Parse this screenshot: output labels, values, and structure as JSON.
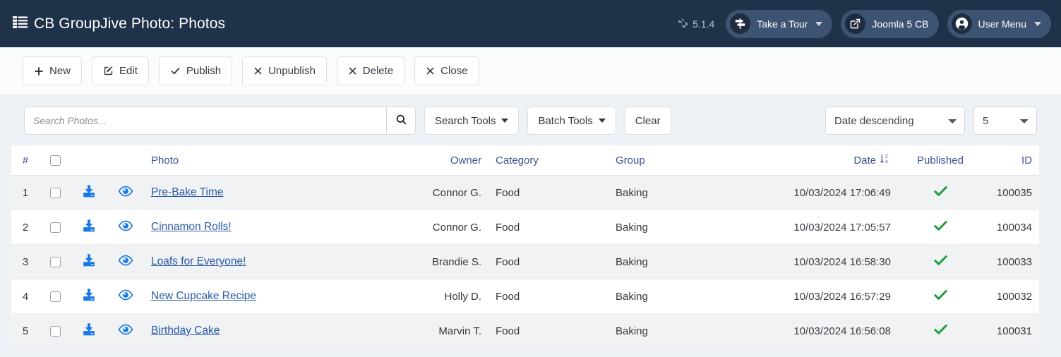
{
  "header": {
    "title": "CB GroupJive Photo: Photos",
    "title_icon": "list-icon",
    "version": "5.1.4",
    "version_icon": "joomla-logo-icon",
    "tour_button": {
      "label": "Take a Tour",
      "icon": "signpost-icon"
    },
    "joomla_button": {
      "label": "Joomla 5 CB",
      "icon": "external-link-icon"
    },
    "user_menu": {
      "label": "User Menu",
      "icon": "user-circle-icon"
    }
  },
  "toolbar": {
    "buttons": [
      {
        "label": "New",
        "icon": "plus-icon"
      },
      {
        "label": "Edit",
        "icon": "pencil-square-icon"
      },
      {
        "label": "Publish",
        "icon": "check-icon"
      },
      {
        "label": "Unpublish",
        "icon": "x-icon"
      },
      {
        "label": "Delete",
        "icon": "x-icon"
      },
      {
        "label": "Close",
        "icon": "x-icon"
      }
    ]
  },
  "filters": {
    "search_placeholder": "Search Photos...",
    "search_value": "",
    "search_icon": "search-icon",
    "search_tools_label": "Search Tools",
    "batch_tools_label": "Batch Tools",
    "clear_label": "Clear",
    "sort_value": "Date descending",
    "sort_options": [
      "Date descending"
    ],
    "limit_value": "5",
    "limit_options": [
      "5"
    ]
  },
  "table": {
    "columns": {
      "num": "#",
      "photo": "Photo",
      "owner": "Owner",
      "category": "Category",
      "group": "Group",
      "date": "Date",
      "published": "Published",
      "id": "ID"
    },
    "sort_indicator": {
      "column": "Date",
      "icon": "sort-down-za-icon"
    },
    "rows": [
      {
        "num": "1",
        "photo": "Pre-Bake Time",
        "owner": "Connor G.",
        "category": "Food",
        "group": "Baking",
        "date": "10/03/2024 17:06:49",
        "published": "published-check-icon",
        "id": "100035"
      },
      {
        "num": "2",
        "photo": "Cinnamon Rolls!",
        "owner": "Connor G.",
        "category": "Food",
        "group": "Baking",
        "date": "10/03/2024 17:05:57",
        "published": "published-check-icon",
        "id": "100034"
      },
      {
        "num": "3",
        "photo": "Loafs for Everyone!",
        "owner": "Brandie S.",
        "category": "Food",
        "group": "Baking",
        "date": "10/03/2024 16:58:30",
        "published": "published-check-icon",
        "id": "100033"
      },
      {
        "num": "4",
        "photo": "New Cupcake Recipe",
        "owner": "Holly D.",
        "category": "Food",
        "group": "Baking",
        "date": "10/03/2024 16:57:29",
        "published": "published-check-icon",
        "id": "100032"
      },
      {
        "num": "5",
        "photo": "Birthday Cake",
        "owner": "Marvin T.",
        "category": "Food",
        "group": "Baking",
        "date": "10/03/2024 16:56:08",
        "published": "published-check-icon",
        "id": "100031"
      }
    ]
  },
  "colors": {
    "header_bg": "#20324a",
    "pill_bg": "#3c5472",
    "link_blue": "#2a5aa8",
    "th_blue": "#3d5296",
    "icon_blue": "#1878e8",
    "published_green": "#1f9b3e",
    "page_bg": "#eef1f6"
  }
}
